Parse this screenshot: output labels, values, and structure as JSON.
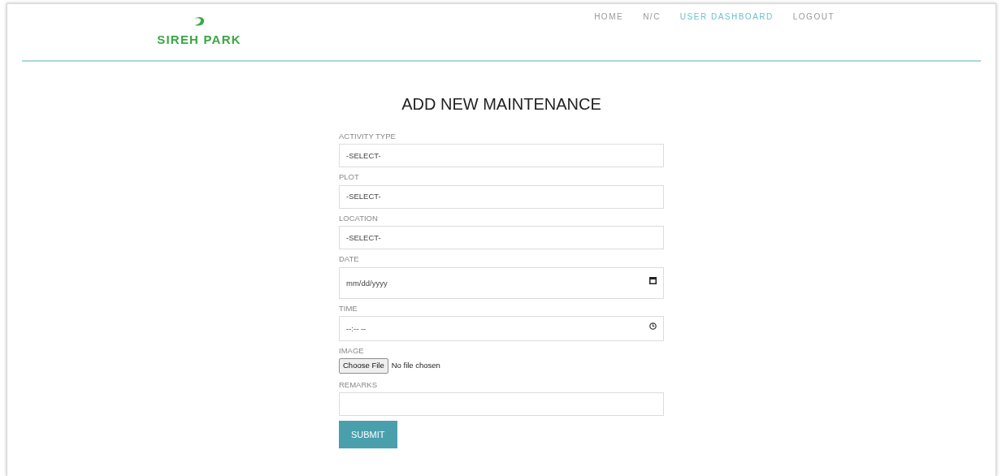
{
  "brand": {
    "name": "SIREH PARK"
  },
  "nav": [
    {
      "label": "HOME",
      "selected": false
    },
    {
      "label": "N/C",
      "selected": false
    },
    {
      "label": "USER DASHBOARD",
      "selected": true
    },
    {
      "label": "LOGOUT",
      "selected": false
    }
  ],
  "form": {
    "title": "ADD NEW MAINTENANCE",
    "fields": [
      {
        "kind": "select",
        "label": "ACTIVITY TYPE",
        "value": "-SELECT-"
      },
      {
        "kind": "select",
        "label": "PLOT",
        "value": "-SELECT-"
      },
      {
        "kind": "select",
        "label": "LOCATION",
        "value": "-SELECT-"
      },
      {
        "kind": "date",
        "label": "DATE",
        "placeholder": "mm/dd/yyyy"
      },
      {
        "kind": "time",
        "label": "TIME",
        "placeholder": "--:-- --"
      },
      {
        "kind": "file",
        "label": "IMAGE",
        "button": "Choose File",
        "status": "No file chosen"
      },
      {
        "kind": "text",
        "label": "REMARKS"
      }
    ],
    "submit": "SUBMIT"
  }
}
